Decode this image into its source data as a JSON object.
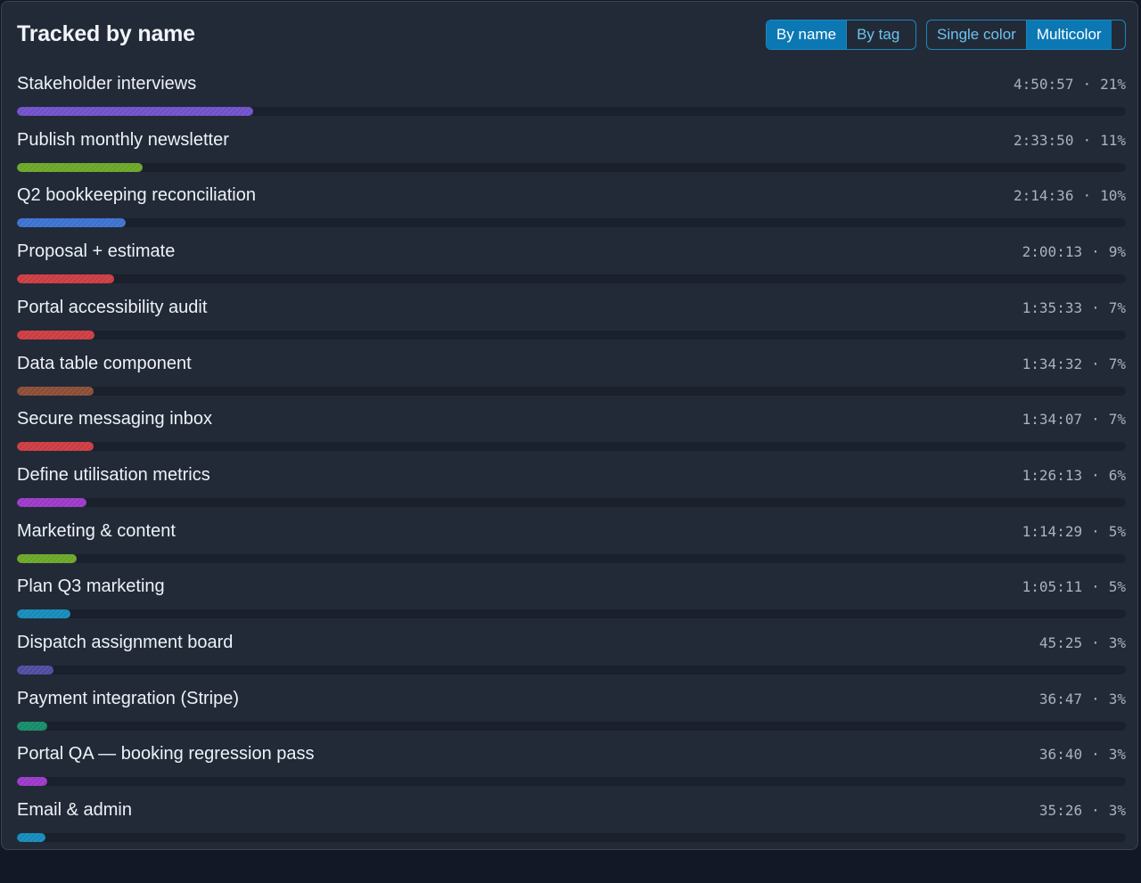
{
  "panel": {
    "title": "Tracked by name",
    "group_toggle": {
      "by_name": "By name",
      "by_tag": "By tag",
      "active": "by_name"
    },
    "color_toggle": {
      "single": "Single color",
      "multi": "Multicolor",
      "active": "multi"
    }
  },
  "separator": "·",
  "rows": [
    {
      "name": "Stakeholder interviews",
      "duration": "4:50:57",
      "percent": "21%",
      "share": 0.213,
      "color": "#6f4fc9"
    },
    {
      "name": "Publish monthly newsletter",
      "duration": "2:33:50",
      "percent": "11%",
      "share": 0.113,
      "color": "#6aa526"
    },
    {
      "name": "Q2 bookkeeping reconciliation",
      "duration": "2:14:36",
      "percent": "10%",
      "share": 0.098,
      "color": "#3a70cf"
    },
    {
      "name": "Proposal + estimate",
      "duration": "2:00:13",
      "percent": "9%",
      "share": 0.088,
      "color": "#cb3a3f"
    },
    {
      "name": "Portal accessibility audit",
      "duration": "1:35:33",
      "percent": "7%",
      "share": 0.07,
      "color": "#cb3a3f"
    },
    {
      "name": "Data table component",
      "duration": "1:34:32",
      "percent": "7%",
      "share": 0.069,
      "color": "#8a4b33"
    },
    {
      "name": "Secure messaging inbox",
      "duration": "1:34:07",
      "percent": "7%",
      "share": 0.069,
      "color": "#cb3a3f"
    },
    {
      "name": "Define utilisation metrics",
      "duration": "1:26:13",
      "percent": "6%",
      "share": 0.063,
      "color": "#9a37c7"
    },
    {
      "name": "Marketing & content",
      "duration": "1:14:29",
      "percent": "5%",
      "share": 0.054,
      "color": "#6aa526"
    },
    {
      "name": "Plan Q3 marketing",
      "duration": "1:05:11",
      "percent": "5%",
      "share": 0.048,
      "color": "#1489b8"
    },
    {
      "name": "Dispatch assignment board",
      "duration": "45:25",
      "percent": "3%",
      "share": 0.033,
      "color": "#4d4a9e"
    },
    {
      "name": "Payment integration (Stripe)",
      "duration": "36:47",
      "percent": "3%",
      "share": 0.027,
      "color": "#148a66"
    },
    {
      "name": "Portal QA — booking regression pass",
      "duration": "36:40",
      "percent": "3%",
      "share": 0.027,
      "color": "#9a37c7"
    },
    {
      "name": "Email & admin",
      "duration": "35:26",
      "percent": "3%",
      "share": 0.026,
      "color": "#1489b8"
    }
  ]
}
